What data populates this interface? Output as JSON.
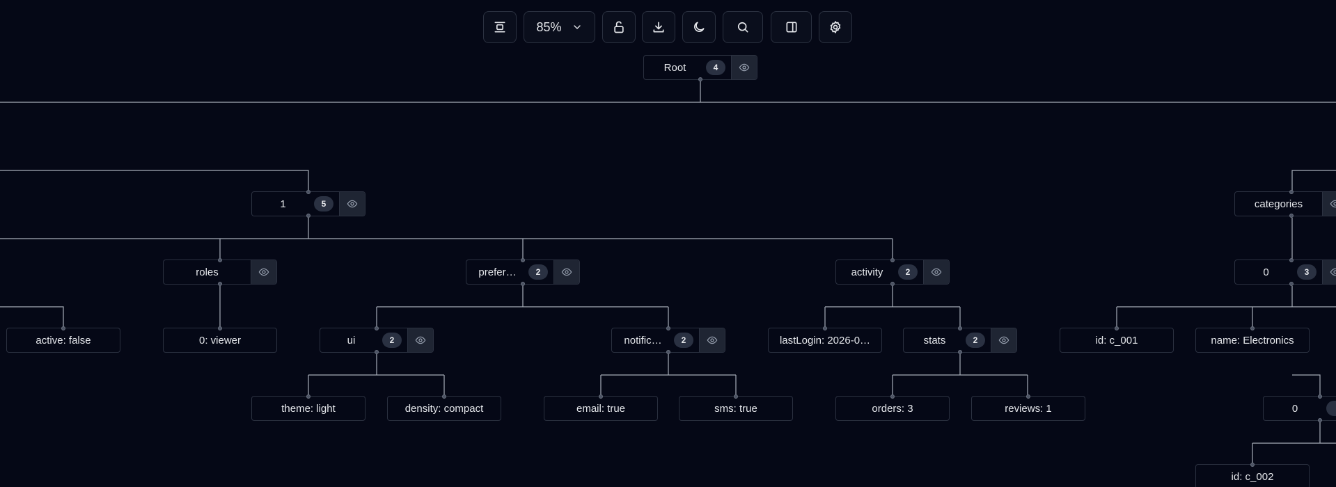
{
  "toolbar": {
    "zoom_label": "85%",
    "buttons": [
      {
        "name": "align-center-button",
        "icon": "align-center-icon"
      },
      {
        "name": "lock-button",
        "icon": "unlock-icon"
      },
      {
        "name": "download-button",
        "icon": "download-icon"
      },
      {
        "name": "theme-toggle-button",
        "icon": "moon-icon"
      },
      {
        "name": "search-button",
        "icon": "search-icon"
      },
      {
        "name": "panel-toggle-button",
        "icon": "sidebar-icon"
      },
      {
        "name": "settings-button",
        "icon": "gear-icon"
      }
    ]
  },
  "colors": {
    "background": "#050816",
    "edge": "#a7adb8",
    "node_border": "#2b3140",
    "badge_bg": "#2a3142",
    "eye_bg": "#1f2533"
  },
  "nodes": {
    "root": {
      "label": "Root",
      "count": "4"
    },
    "item_1": {
      "label": "1",
      "count": "5"
    },
    "roles": {
      "label": "roles"
    },
    "preferences": {
      "label": "prefer…",
      "count": "2"
    },
    "activity": {
      "label": "activity",
      "count": "2"
    },
    "active": {
      "label": "active: false"
    },
    "roles_0": {
      "label": "0: viewer"
    },
    "ui": {
      "label": "ui",
      "count": "2"
    },
    "notifications": {
      "label": "notific…",
      "count": "2"
    },
    "last_login": {
      "label": "lastLogin: 2026-0…"
    },
    "stats": {
      "label": "stats",
      "count": "2"
    },
    "theme": {
      "label": "theme: light"
    },
    "density": {
      "label": "density: compact"
    },
    "email": {
      "label": "email: true"
    },
    "sms": {
      "label": "sms: true"
    },
    "orders": {
      "label": "orders: 3"
    },
    "reviews": {
      "label": "reviews: 1"
    },
    "categories": {
      "label": "categories"
    },
    "categories_0": {
      "label": "0",
      "count": "3"
    },
    "cat_id": {
      "label": "id: c_001"
    },
    "cat_name": {
      "label": "name: Electronics"
    },
    "sub_0": {
      "label": "0"
    },
    "sub_id": {
      "label": "id: c_002"
    }
  }
}
